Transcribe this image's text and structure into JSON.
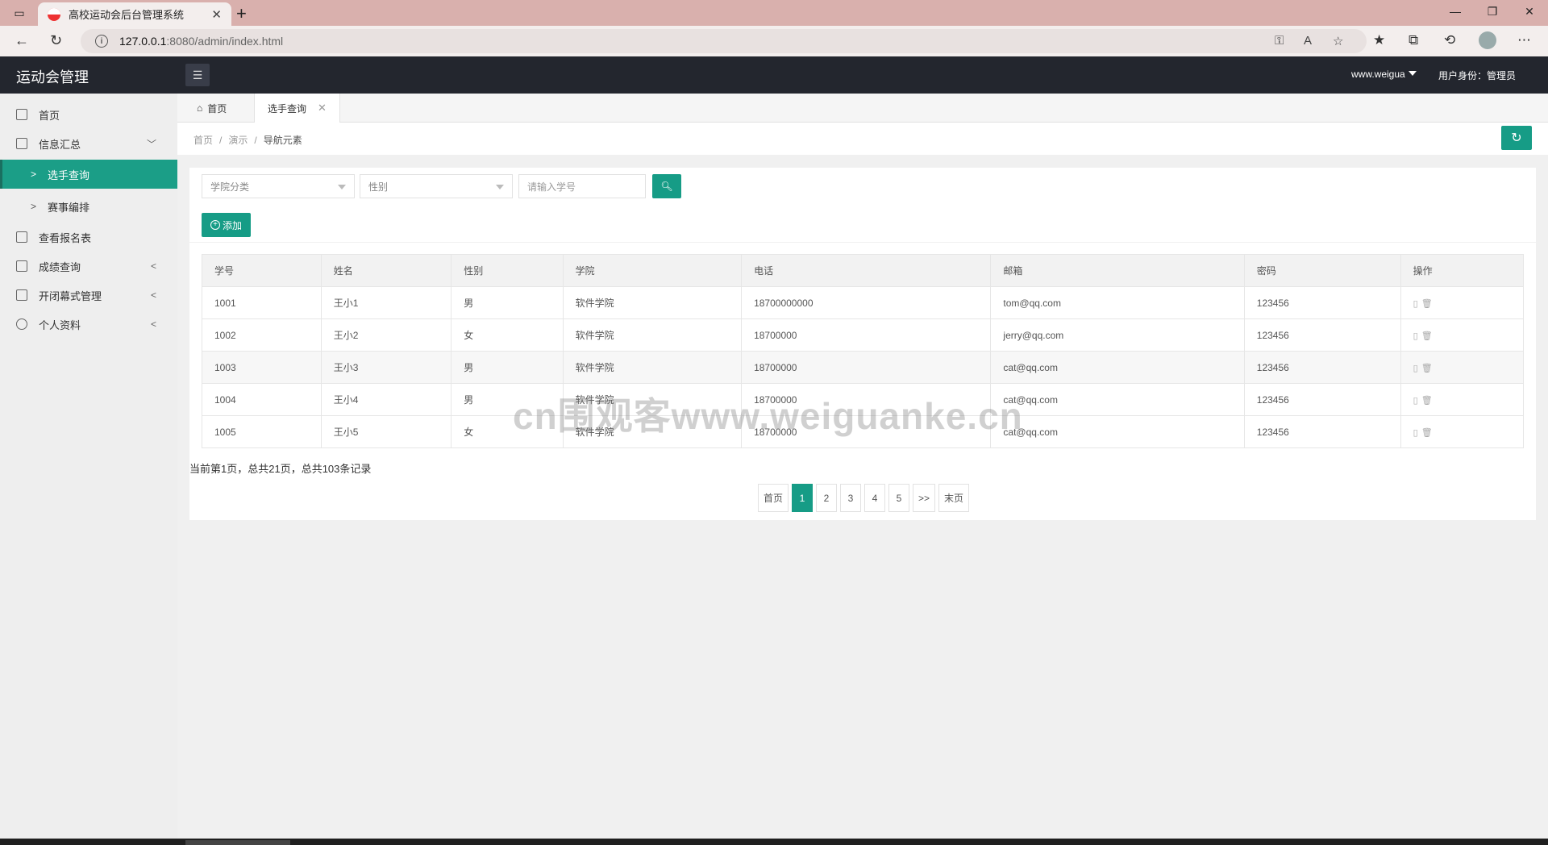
{
  "browser": {
    "tab_title": "高校运动会后台管理系统",
    "url_host": "127.0.0.1",
    "url_path": ":8080/admin/index.html"
  },
  "header": {
    "logo": "运动会管理",
    "username": "www.weigua",
    "role": "用户身份：管理员"
  },
  "sidebar": {
    "items": [
      {
        "label": "首页",
        "icon": "grid-icon"
      },
      {
        "label": "信息汇总",
        "icon": "doc-icon"
      },
      {
        "label": "选手查询"
      },
      {
        "label": "赛事编排"
      },
      {
        "label": "查看报名表",
        "icon": "list-icon"
      },
      {
        "label": "成绩查询",
        "icon": "doc-icon"
      },
      {
        "label": "开闭幕式管理",
        "icon": "doc-icon"
      },
      {
        "label": "个人资料",
        "icon": "user-icon"
      }
    ]
  },
  "page_tabs": {
    "home": "首页",
    "current": "选手查询"
  },
  "breadcrumb": {
    "items": [
      "首页",
      "演示",
      "导航元素"
    ]
  },
  "filters": {
    "college": "学院分类",
    "gender": "性别",
    "search_placeholder": "请输入学号",
    "add_label": "添加"
  },
  "table": {
    "headers": [
      "学号",
      "姓名",
      "性别",
      "学院",
      "电话",
      "邮箱",
      "密码",
      "操作"
    ],
    "rows": [
      [
        "1001",
        "王小1",
        "男",
        "软件学院",
        "18700000000",
        "tom@qq.com",
        "123456"
      ],
      [
        "1002",
        "王小2",
        "女",
        "软件学院",
        "18700000",
        "jerry@qq.com",
        "123456"
      ],
      [
        "1003",
        "王小3",
        "男",
        "软件学院",
        "18700000",
        "cat@qq.com",
        "123456"
      ],
      [
        "1004",
        "王小4",
        "男",
        "软件学院",
        "18700000",
        "cat@qq.com",
        "123456"
      ],
      [
        "1005",
        "王小5",
        "女",
        "软件学院",
        "18700000",
        "cat@qq.com",
        "123456"
      ]
    ]
  },
  "pagination": {
    "summary": "当前第1页，总共21页，总共103条记录",
    "first": "首页",
    "pages": [
      "1",
      "2",
      "3",
      "4",
      "5"
    ],
    "next": ">>",
    "last": "末页",
    "current": "1"
  },
  "watermark": "cn围观客www.weiguanke.cn",
  "colors": {
    "accent": "#169c86",
    "header_bg": "#23262e",
    "titlebar": "#d9b0ad"
  }
}
